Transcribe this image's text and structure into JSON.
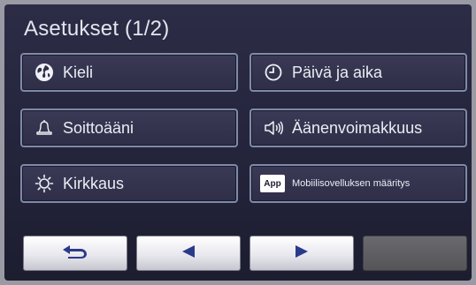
{
  "header": {
    "title": "Asetukset (1/2)"
  },
  "tiles": [
    {
      "label": "Kieli",
      "icon": "globe-icon"
    },
    {
      "label": "Päivä ja aika",
      "icon": "clock-icon"
    },
    {
      "label": "Soittoääni",
      "icon": "bell-icon"
    },
    {
      "label": "Äänenvoimakkuus",
      "icon": "speaker-icon"
    },
    {
      "label": "Kirkkaus",
      "icon": "sun-icon"
    },
    {
      "label": "Mobiilisovelluksen määritys",
      "icon": "app-icon",
      "badge": "App"
    }
  ],
  "nav": {
    "back_icon": "return-arrow-icon",
    "prev_icon": "triangle-left-icon",
    "next_icon": "triangle-right-icon"
  },
  "colors": {
    "background": "#23233a",
    "tile_border": "#7f8aa8",
    "nav_light": "#e8e8ee",
    "nav_dark": "#5a5a5e",
    "arrow": "#2a3a8a"
  }
}
